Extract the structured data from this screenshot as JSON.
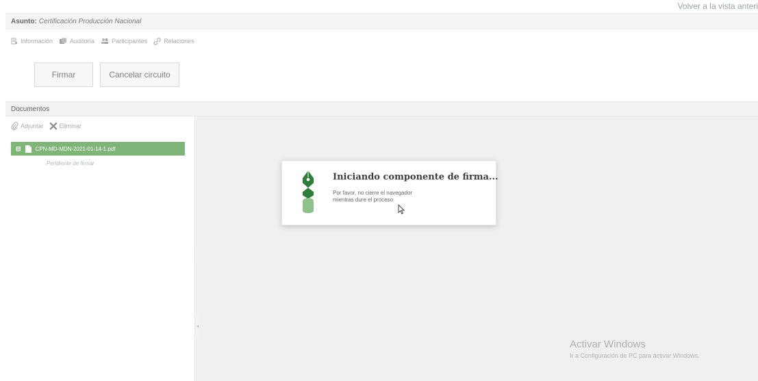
{
  "header": {
    "back_link": "Volver a la vista anteri"
  },
  "subject": {
    "label": "Asunto:",
    "value": "Certificación Producción Nacional"
  },
  "tabs": [
    {
      "label": "Información",
      "icon": "info-doc-icon"
    },
    {
      "label": "Auditoría",
      "icon": "audit-stack-icon"
    },
    {
      "label": "Participantes",
      "icon": "participants-icon"
    },
    {
      "label": "Relaciones",
      "icon": "link-icon"
    }
  ],
  "actions": {
    "sign_label": "Firmar",
    "cancel_label": "Cancelar circuito"
  },
  "documents": {
    "header": "Documentos",
    "attach_label": "Adjuntar",
    "delete_label": "Eliminar",
    "items": [
      {
        "expander": "⊟",
        "name": "CPN-MD-MDN-2021-01-14-1.pdf",
        "status": "Pendiente de firmar"
      }
    ]
  },
  "dialog": {
    "title": "Iniciando componente de firma...",
    "message_line1": "Por favor, no cierre el navegador",
    "message_line2": "mientras dure el proceso"
  },
  "watermark": {
    "title": "Activar Windows",
    "subtitle": "Ir a Configuración de PC para activar Windows."
  },
  "colors": {
    "selected_row": "#80b57a",
    "logo_green": "#2f7d3a",
    "viewer_background": "#eff0f1"
  }
}
